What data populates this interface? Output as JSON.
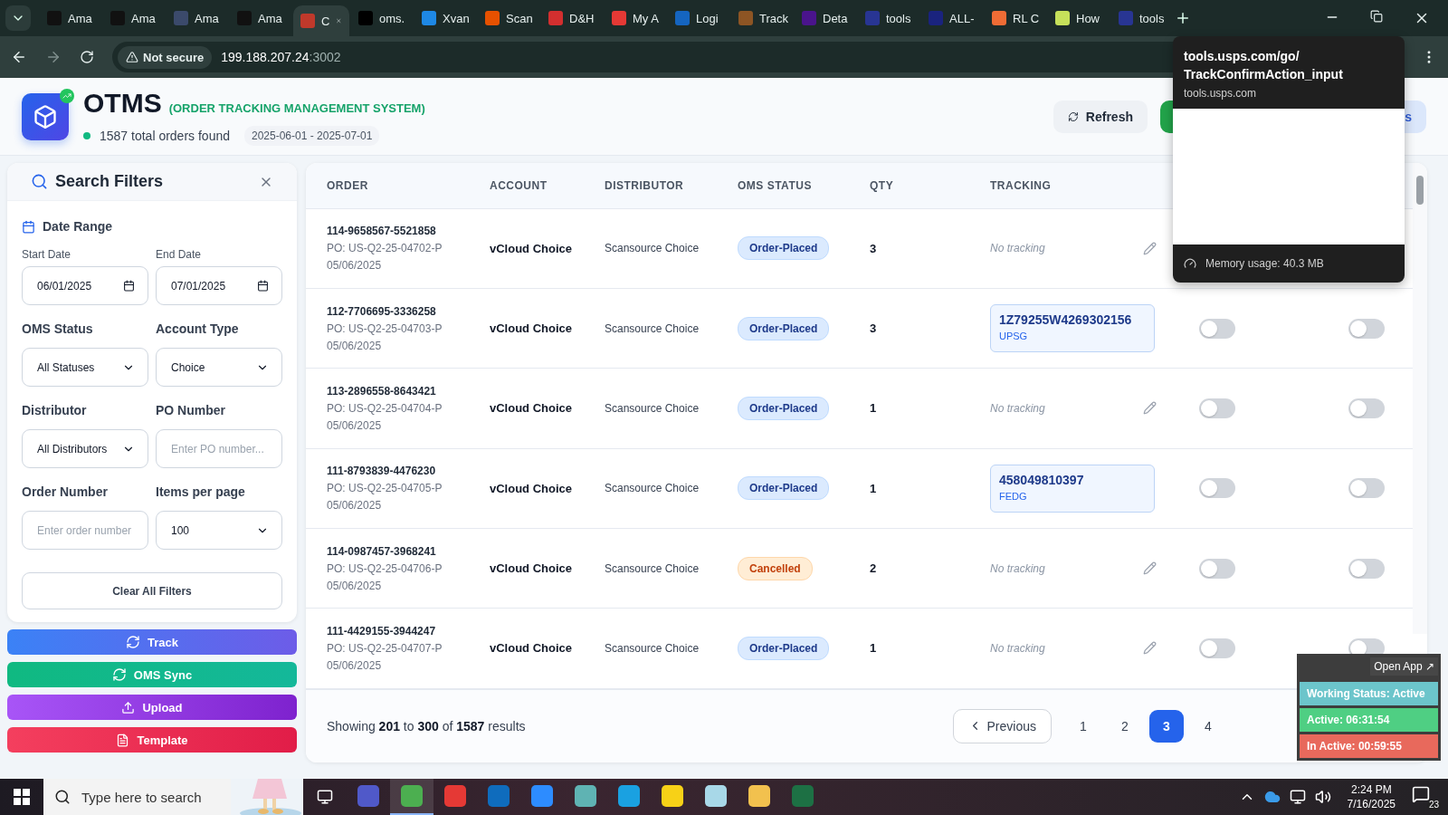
{
  "browser": {
    "tabs": [
      {
        "title": "Ama",
        "color": "#111111",
        "selected": false
      },
      {
        "title": "Ama",
        "color": "#111111",
        "selected": false
      },
      {
        "title": "Ama",
        "color": "#3b4a6b",
        "selected": false
      },
      {
        "title": "Ama",
        "color": "#111111",
        "selected": false
      },
      {
        "title": "C",
        "color": "#c0392b",
        "selected": true
      },
      {
        "title": "oms.",
        "color": "#000000",
        "selected": false
      },
      {
        "title": "Xvan",
        "color": "#1e88e5",
        "selected": false
      },
      {
        "title": "Scan",
        "color": "#e65100",
        "selected": false
      },
      {
        "title": "D&H",
        "color": "#d32f2f",
        "selected": false
      },
      {
        "title": "My A",
        "color": "#e53935",
        "selected": false
      },
      {
        "title": "Logi",
        "color": "#1565c0",
        "selected": false
      },
      {
        "title": "Track",
        "color": "#8d5524",
        "selected": false
      },
      {
        "title": "Deta",
        "color": "#4a148c",
        "selected": false
      },
      {
        "title": "tools",
        "color": "#283593",
        "selected": false
      },
      {
        "title": "ALL-",
        "color": "#1a237e",
        "selected": false
      },
      {
        "title": "RL C",
        "color": "#ef6c35",
        "selected": false
      },
      {
        "title": "How",
        "color": "#c6e05a",
        "selected": false
      },
      {
        "title": "tools",
        "color": "#283593",
        "selected": false
      }
    ],
    "security": "Not secure",
    "address": "199.188.207.24",
    "port": ":3002",
    "tab_preview": {
      "title_lines": [
        "tools.usps.com/go/",
        "TrackConfirmAction_input"
      ],
      "domain": "tools.usps.com",
      "memory": "Memory usage: 40.3 MB"
    }
  },
  "header": {
    "title": "OTMS",
    "subtitle": "(ORDER TRACKING MANAGEMENT SYSTEM)",
    "count": "1587 total orders found",
    "date_range": "2025-06-01 - 2025-07-01",
    "actions": [
      {
        "kind": "refresh",
        "label": "Refresh"
      },
      {
        "kind": "green"
      },
      {
        "kind": "light",
        "label": "s"
      }
    ]
  },
  "filters": {
    "title": "Search Filters",
    "section": "Date Range",
    "start_label": "Start Date",
    "start": "06/01/2025",
    "end_label": "End Date",
    "end": "07/01/2025",
    "fields": [
      {
        "label": "OMS Status",
        "kind": "select",
        "value": "All Statuses"
      },
      {
        "label": "Account Type",
        "kind": "select",
        "value": "Choice"
      },
      {
        "label": "Distributor",
        "kind": "select",
        "value": "All Distributors"
      },
      {
        "label": "PO Number",
        "kind": "input",
        "placeholder": "Enter PO number..."
      },
      {
        "label": "Order Number",
        "kind": "input",
        "placeholder": "Enter order number"
      },
      {
        "label": "Items per page",
        "kind": "select",
        "value": "100"
      }
    ],
    "clear": "Clear All Filters"
  },
  "side_buttons": [
    {
      "kind": "track",
      "label": "Track"
    },
    {
      "kind": "sync",
      "label": "OMS Sync"
    },
    {
      "kind": "upload",
      "label": "Upload"
    },
    {
      "kind": "template",
      "label": "Template"
    }
  ],
  "table": {
    "columns": [
      "ORDER",
      "ACCOUNT",
      "DISTRIBUTOR",
      "OMS STATUS",
      "QTY",
      "TRACKING"
    ],
    "rows": [
      {
        "order": "114-9658567-5521858",
        "po": "PO: US-Q2-25-04702-P",
        "date": "05/06/2025",
        "account": "vCloud Choice",
        "distributor": "Scansource Choice",
        "status": "Order-Placed",
        "cancelled": false,
        "qty": "3",
        "tracking": "No tracking"
      },
      {
        "order": "112-7706695-3336258",
        "po": "PO: US-Q2-25-04703-P",
        "date": "05/06/2025",
        "account": "vCloud Choice",
        "distributor": "Scansource Choice",
        "status": "Order-Placed",
        "cancelled": false,
        "qty": "3",
        "tracking_number": "1Z79255W4269302156",
        "carrier": "UPSG",
        "toggles": [
          {
            "on": false
          },
          {
            "on": false
          }
        ]
      },
      {
        "order": "113-2896558-8643421",
        "po": "PO: US-Q2-25-04704-P",
        "date": "05/06/2025",
        "account": "vCloud Choice",
        "distributor": "Scansource Choice",
        "status": "Order-Placed",
        "cancelled": false,
        "qty": "1",
        "tracking": "No tracking",
        "toggles": [
          {
            "on": false
          },
          {
            "on": false
          }
        ]
      },
      {
        "order": "111-8793839-4476230",
        "po": "PO: US-Q2-25-04705-P",
        "date": "05/06/2025",
        "account": "vCloud Choice",
        "distributor": "Scansource Choice",
        "status": "Order-Placed",
        "cancelled": false,
        "qty": "1",
        "tracking_number": "458049810397",
        "carrier": "FEDG",
        "toggles": [
          {
            "on": false
          },
          {
            "on": false
          }
        ]
      },
      {
        "order": "114-0987457-3968241",
        "po": "PO: US-Q2-25-04706-P",
        "date": "05/06/2025",
        "account": "vCloud Choice",
        "distributor": "Scansource Choice",
        "status": "Cancelled",
        "cancelled": true,
        "qty": "2",
        "tracking": "No tracking",
        "toggles": [
          {
            "on": false
          },
          {
            "on": false
          }
        ]
      },
      {
        "order": "111-4429155-3944247",
        "po": "PO: US-Q2-25-04707-P",
        "date": "05/06/2025",
        "account": "vCloud Choice",
        "distributor": "Scansource Choice",
        "status": "Order-Placed",
        "cancelled": false,
        "qty": "1",
        "tracking": "No tracking",
        "toggles": [
          {
            "on": false
          },
          {
            "on": false
          }
        ]
      }
    ],
    "summary": "Showing **201** to **300** of **1587** results",
    "pagination": {
      "previous": "Previous",
      "pages": [
        {
          "label": "1",
          "selected": false
        },
        {
          "label": "2",
          "selected": false
        },
        {
          "label": "3",
          "selected": true
        },
        {
          "label": "4",
          "selected": false
        }
      ]
    }
  },
  "status_widget": {
    "open": "Open App ↗",
    "rows": [
      {
        "text": "Working Status: Active",
        "color": "#6cc5cb"
      },
      {
        "text": "Active: 06:31:54",
        "color": "#4fcf83"
      },
      {
        "text": "In Active: 00:59:55",
        "color": "#e8695c"
      }
    ]
  },
  "taskbar": {
    "search_placeholder": "Type here to search",
    "apps": [
      {
        "color": "#5059c9",
        "selected": false
      },
      {
        "color": "#4caf50",
        "selected": true
      },
      {
        "color": "#e53935",
        "selected": false
      },
      {
        "color": "#0f6cbd",
        "selected": false
      },
      {
        "color": "#2d8cff",
        "selected": false
      },
      {
        "color": "#5fb3b3",
        "selected": false
      },
      {
        "color": "#1aa1e1",
        "selected": false
      },
      {
        "color": "#f7d117",
        "selected": false
      },
      {
        "color": "#a8d8e8",
        "selected": false
      },
      {
        "color": "#f2c14e",
        "selected": false
      },
      {
        "color": "#1d7044",
        "selected": false
      }
    ],
    "time": "2:24 PM",
    "date": "7/16/2025",
    "notifications": "23"
  }
}
